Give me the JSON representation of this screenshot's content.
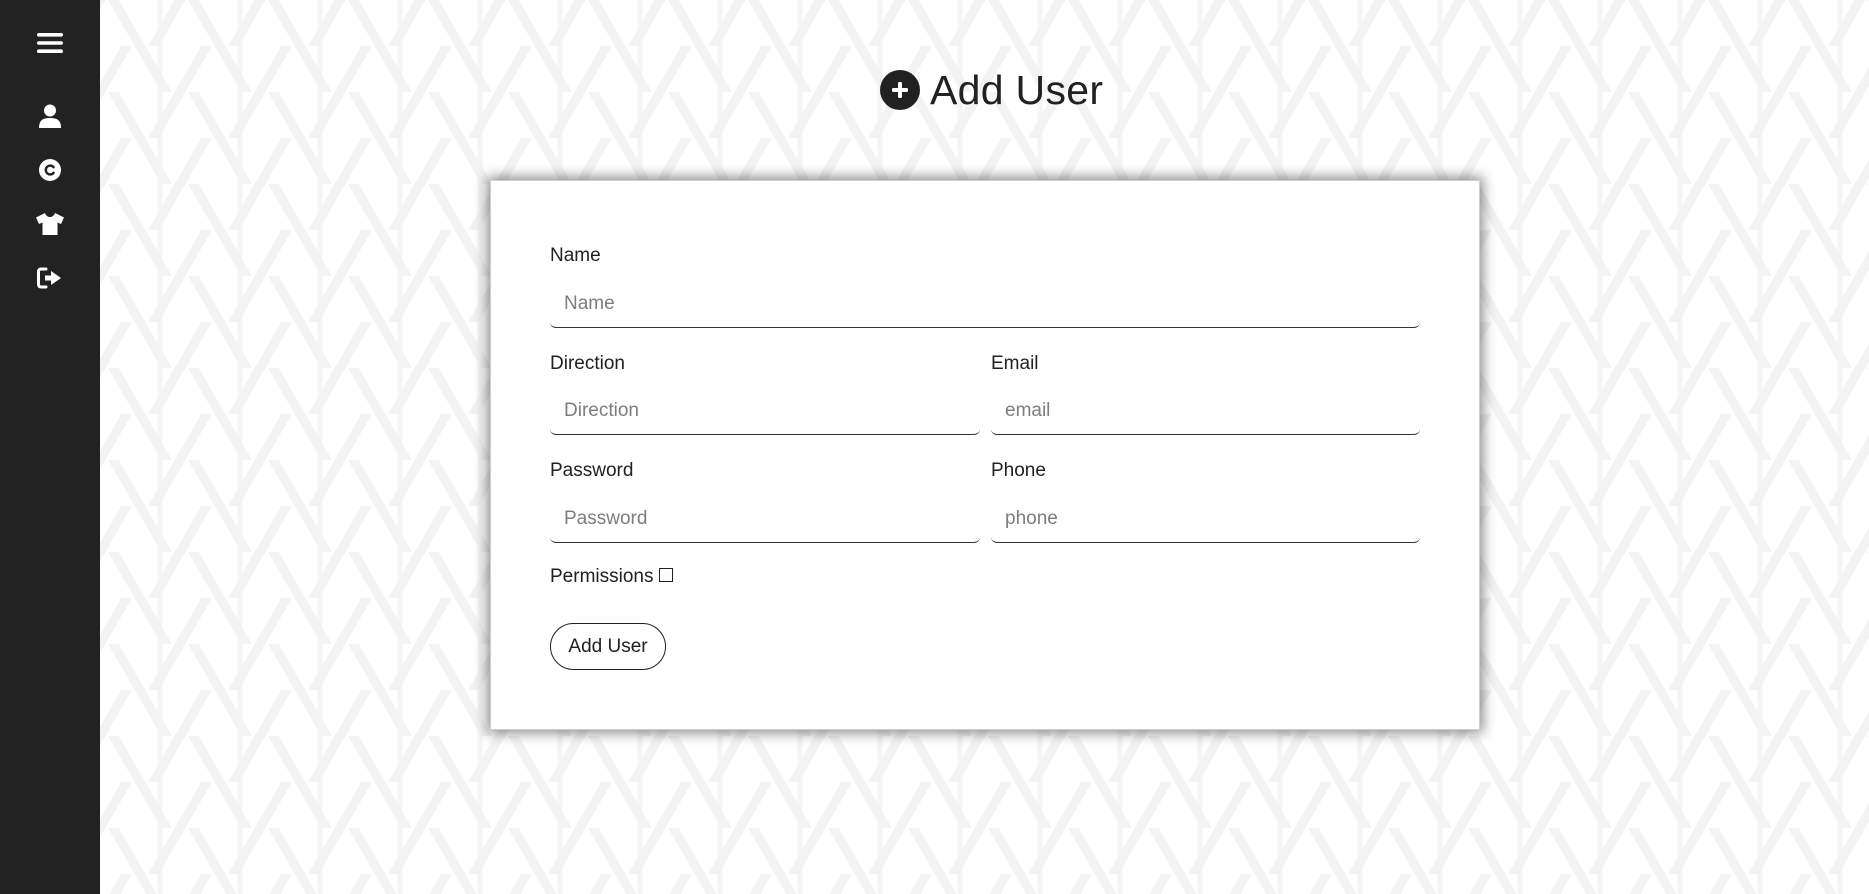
{
  "sidebar": {
    "menu_icon": "hamburger-menu-icon",
    "items": [
      {
        "icon": "user-icon"
      },
      {
        "icon": "copyright-circle-icon"
      },
      {
        "icon": "tshirt-icon"
      },
      {
        "icon": "sign-out-icon"
      }
    ]
  },
  "page": {
    "title": "Add User",
    "title_icon": "plus-circle-icon"
  },
  "form": {
    "name": {
      "label": "Name",
      "placeholder": "Name",
      "value": ""
    },
    "direction": {
      "label": "Direction",
      "placeholder": "Direction",
      "value": ""
    },
    "email": {
      "label": "Email",
      "placeholder": "email",
      "value": ""
    },
    "password": {
      "label": "Password",
      "placeholder": "Password",
      "value": ""
    },
    "phone": {
      "label": "Phone",
      "placeholder": "phone",
      "value": ""
    },
    "permissions": {
      "label": "Permissions",
      "checked": false
    },
    "submit_label": "Add User"
  },
  "colors": {
    "sidebar_bg": "#232222",
    "text": "#212121",
    "card_bg": "#ffffff"
  }
}
